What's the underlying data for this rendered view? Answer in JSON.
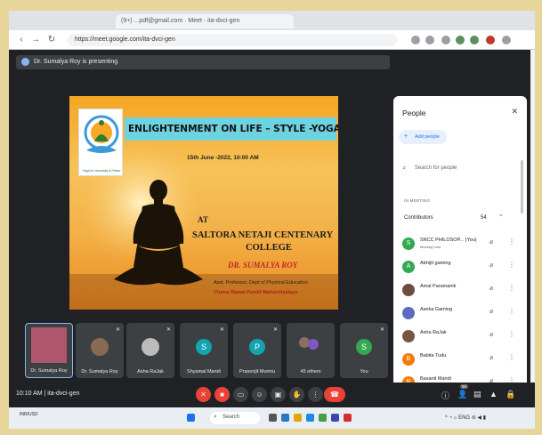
{
  "browser": {
    "tab_text": "(9+) ...pdf@gmail.com · Meet - ita-dvci-gen",
    "url": "https://meet.google.com/ita-dvci-gen",
    "nav": [
      "back-icon",
      "forward-icon",
      "reload-icon"
    ]
  },
  "meet": {
    "presenting_text": "Dr. Sumalya Roy is presenting",
    "time": "10:10 AM",
    "meeting_code": "ita-dvci-gen",
    "participant_badge": "54"
  },
  "slide": {
    "title": "ENLIGHTENMENT ON LIFE – STYLE -YOGA .",
    "date": "15th June -2022, 10:00 AM",
    "at": "AT",
    "college_line1": "SALTORA NETAJI CENTENARY",
    "college_line2": "COLLEGE",
    "speaker": "DR. SUMALYA ROY",
    "designation": "Asst. Professor, Dept of Physical Education",
    "institution": "Chatra Ramai Pandit Mahavidyalaya",
    "logo_text": "Yoga for Humanity & Peace"
  },
  "tiles": [
    {
      "name": "Dr. Sumalya Roy",
      "kind": "photo"
    },
    {
      "name": "Dr. Sumalya Roy",
      "kind": "photo"
    },
    {
      "name": "Asha RaJak",
      "kind": "photo"
    },
    {
      "name": "Shyamal Mandi",
      "kind": "letter",
      "letter": "S",
      "color": "#12a4af"
    },
    {
      "name": "Prasenjit Murmu",
      "kind": "letter",
      "letter": "P",
      "color": "#12a4af"
    },
    {
      "name": "45 others",
      "kind": "others"
    },
    {
      "name": "You",
      "kind": "letter",
      "letter": "S",
      "color": "#34a853"
    }
  ],
  "people": {
    "title": "People",
    "add_people": "Add people",
    "search_placeholder": "Search for people",
    "in_meeting": "IN MEETING",
    "contributors_label": "Contributors",
    "contributors_count": "54",
    "list": [
      {
        "name": "SNCC PHILOSOP... (You)",
        "sub": "Meeting host",
        "letter": "S",
        "color": "#34a853"
      },
      {
        "name": "Abhijit gaming",
        "sub": "",
        "letter": "A",
        "color": "#34a853"
      },
      {
        "name": "Amal Paramanik",
        "sub": "",
        "letter": "",
        "color": "#6d4c41"
      },
      {
        "name": "Aseka Gaming",
        "sub": "",
        "letter": "",
        "color": "#5c6bc0"
      },
      {
        "name": "Asha RaJak",
        "sub": "",
        "letter": "",
        "color": "#795548"
      },
      {
        "name": "Babita Tudu",
        "sub": "",
        "letter": "B",
        "color": "#f57c00"
      },
      {
        "name": "Basanti Mandi",
        "sub": "",
        "letter": "B",
        "color": "#f57c00"
      }
    ]
  },
  "taskbar": {
    "weather": "INR/USD",
    "search": "Search"
  },
  "colors": {
    "accent": "#1a73e8",
    "hangup": "#ea4335",
    "meet_bg": "#202124"
  }
}
